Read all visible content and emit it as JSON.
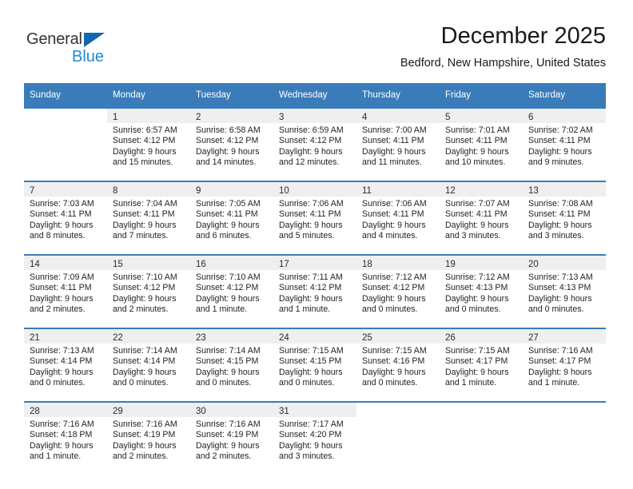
{
  "brand": {
    "name_part1": "General",
    "name_part2": "Blue",
    "triangle_color": "#1167b1",
    "blue_text_color": "#1f8ad6"
  },
  "header": {
    "title": "December 2025",
    "subtitle": "Bedford, New Hampshire, United States",
    "header_bg_color": "#3a7cba",
    "daynum_bg_color": "#efefef"
  },
  "weekdays": [
    "Sunday",
    "Monday",
    "Tuesday",
    "Wednesday",
    "Thursday",
    "Friday",
    "Saturday"
  ],
  "weeks": [
    [
      {
        "day": "",
        "sunrise": "",
        "sunset": "",
        "daylight1": "",
        "daylight2": ""
      },
      {
        "day": "1",
        "sunrise": "Sunrise: 6:57 AM",
        "sunset": "Sunset: 4:12 PM",
        "daylight1": "Daylight: 9 hours",
        "daylight2": "and 15 minutes."
      },
      {
        "day": "2",
        "sunrise": "Sunrise: 6:58 AM",
        "sunset": "Sunset: 4:12 PM",
        "daylight1": "Daylight: 9 hours",
        "daylight2": "and 14 minutes."
      },
      {
        "day": "3",
        "sunrise": "Sunrise: 6:59 AM",
        "sunset": "Sunset: 4:12 PM",
        "daylight1": "Daylight: 9 hours",
        "daylight2": "and 12 minutes."
      },
      {
        "day": "4",
        "sunrise": "Sunrise: 7:00 AM",
        "sunset": "Sunset: 4:11 PM",
        "daylight1": "Daylight: 9 hours",
        "daylight2": "and 11 minutes."
      },
      {
        "day": "5",
        "sunrise": "Sunrise: 7:01 AM",
        "sunset": "Sunset: 4:11 PM",
        "daylight1": "Daylight: 9 hours",
        "daylight2": "and 10 minutes."
      },
      {
        "day": "6",
        "sunrise": "Sunrise: 7:02 AM",
        "sunset": "Sunset: 4:11 PM",
        "daylight1": "Daylight: 9 hours",
        "daylight2": "and 9 minutes."
      }
    ],
    [
      {
        "day": "7",
        "sunrise": "Sunrise: 7:03 AM",
        "sunset": "Sunset: 4:11 PM",
        "daylight1": "Daylight: 9 hours",
        "daylight2": "and 8 minutes."
      },
      {
        "day": "8",
        "sunrise": "Sunrise: 7:04 AM",
        "sunset": "Sunset: 4:11 PM",
        "daylight1": "Daylight: 9 hours",
        "daylight2": "and 7 minutes."
      },
      {
        "day": "9",
        "sunrise": "Sunrise: 7:05 AM",
        "sunset": "Sunset: 4:11 PM",
        "daylight1": "Daylight: 9 hours",
        "daylight2": "and 6 minutes."
      },
      {
        "day": "10",
        "sunrise": "Sunrise: 7:06 AM",
        "sunset": "Sunset: 4:11 PM",
        "daylight1": "Daylight: 9 hours",
        "daylight2": "and 5 minutes."
      },
      {
        "day": "11",
        "sunrise": "Sunrise: 7:06 AM",
        "sunset": "Sunset: 4:11 PM",
        "daylight1": "Daylight: 9 hours",
        "daylight2": "and 4 minutes."
      },
      {
        "day": "12",
        "sunrise": "Sunrise: 7:07 AM",
        "sunset": "Sunset: 4:11 PM",
        "daylight1": "Daylight: 9 hours",
        "daylight2": "and 3 minutes."
      },
      {
        "day": "13",
        "sunrise": "Sunrise: 7:08 AM",
        "sunset": "Sunset: 4:11 PM",
        "daylight1": "Daylight: 9 hours",
        "daylight2": "and 3 minutes."
      }
    ],
    [
      {
        "day": "14",
        "sunrise": "Sunrise: 7:09 AM",
        "sunset": "Sunset: 4:11 PM",
        "daylight1": "Daylight: 9 hours",
        "daylight2": "and 2 minutes."
      },
      {
        "day": "15",
        "sunrise": "Sunrise: 7:10 AM",
        "sunset": "Sunset: 4:12 PM",
        "daylight1": "Daylight: 9 hours",
        "daylight2": "and 2 minutes."
      },
      {
        "day": "16",
        "sunrise": "Sunrise: 7:10 AM",
        "sunset": "Sunset: 4:12 PM",
        "daylight1": "Daylight: 9 hours",
        "daylight2": "and 1 minute."
      },
      {
        "day": "17",
        "sunrise": "Sunrise: 7:11 AM",
        "sunset": "Sunset: 4:12 PM",
        "daylight1": "Daylight: 9 hours",
        "daylight2": "and 1 minute."
      },
      {
        "day": "18",
        "sunrise": "Sunrise: 7:12 AM",
        "sunset": "Sunset: 4:12 PM",
        "daylight1": "Daylight: 9 hours",
        "daylight2": "and 0 minutes."
      },
      {
        "day": "19",
        "sunrise": "Sunrise: 7:12 AM",
        "sunset": "Sunset: 4:13 PM",
        "daylight1": "Daylight: 9 hours",
        "daylight2": "and 0 minutes."
      },
      {
        "day": "20",
        "sunrise": "Sunrise: 7:13 AM",
        "sunset": "Sunset: 4:13 PM",
        "daylight1": "Daylight: 9 hours",
        "daylight2": "and 0 minutes."
      }
    ],
    [
      {
        "day": "21",
        "sunrise": "Sunrise: 7:13 AM",
        "sunset": "Sunset: 4:14 PM",
        "daylight1": "Daylight: 9 hours",
        "daylight2": "and 0 minutes."
      },
      {
        "day": "22",
        "sunrise": "Sunrise: 7:14 AM",
        "sunset": "Sunset: 4:14 PM",
        "daylight1": "Daylight: 9 hours",
        "daylight2": "and 0 minutes."
      },
      {
        "day": "23",
        "sunrise": "Sunrise: 7:14 AM",
        "sunset": "Sunset: 4:15 PM",
        "daylight1": "Daylight: 9 hours",
        "daylight2": "and 0 minutes."
      },
      {
        "day": "24",
        "sunrise": "Sunrise: 7:15 AM",
        "sunset": "Sunset: 4:15 PM",
        "daylight1": "Daylight: 9 hours",
        "daylight2": "and 0 minutes."
      },
      {
        "day": "25",
        "sunrise": "Sunrise: 7:15 AM",
        "sunset": "Sunset: 4:16 PM",
        "daylight1": "Daylight: 9 hours",
        "daylight2": "and 0 minutes."
      },
      {
        "day": "26",
        "sunrise": "Sunrise: 7:15 AM",
        "sunset": "Sunset: 4:17 PM",
        "daylight1": "Daylight: 9 hours",
        "daylight2": "and 1 minute."
      },
      {
        "day": "27",
        "sunrise": "Sunrise: 7:16 AM",
        "sunset": "Sunset: 4:17 PM",
        "daylight1": "Daylight: 9 hours",
        "daylight2": "and 1 minute."
      }
    ],
    [
      {
        "day": "28",
        "sunrise": "Sunrise: 7:16 AM",
        "sunset": "Sunset: 4:18 PM",
        "daylight1": "Daylight: 9 hours",
        "daylight2": "and 1 minute."
      },
      {
        "day": "29",
        "sunrise": "Sunrise: 7:16 AM",
        "sunset": "Sunset: 4:19 PM",
        "daylight1": "Daylight: 9 hours",
        "daylight2": "and 2 minutes."
      },
      {
        "day": "30",
        "sunrise": "Sunrise: 7:16 AM",
        "sunset": "Sunset: 4:19 PM",
        "daylight1": "Daylight: 9 hours",
        "daylight2": "and 2 minutes."
      },
      {
        "day": "31",
        "sunrise": "Sunrise: 7:17 AM",
        "sunset": "Sunset: 4:20 PM",
        "daylight1": "Daylight: 9 hours",
        "daylight2": "and 3 minutes."
      },
      {
        "day": "",
        "sunrise": "",
        "sunset": "",
        "daylight1": "",
        "daylight2": ""
      },
      {
        "day": "",
        "sunrise": "",
        "sunset": "",
        "daylight1": "",
        "daylight2": ""
      },
      {
        "day": "",
        "sunrise": "",
        "sunset": "",
        "daylight1": "",
        "daylight2": ""
      }
    ]
  ]
}
